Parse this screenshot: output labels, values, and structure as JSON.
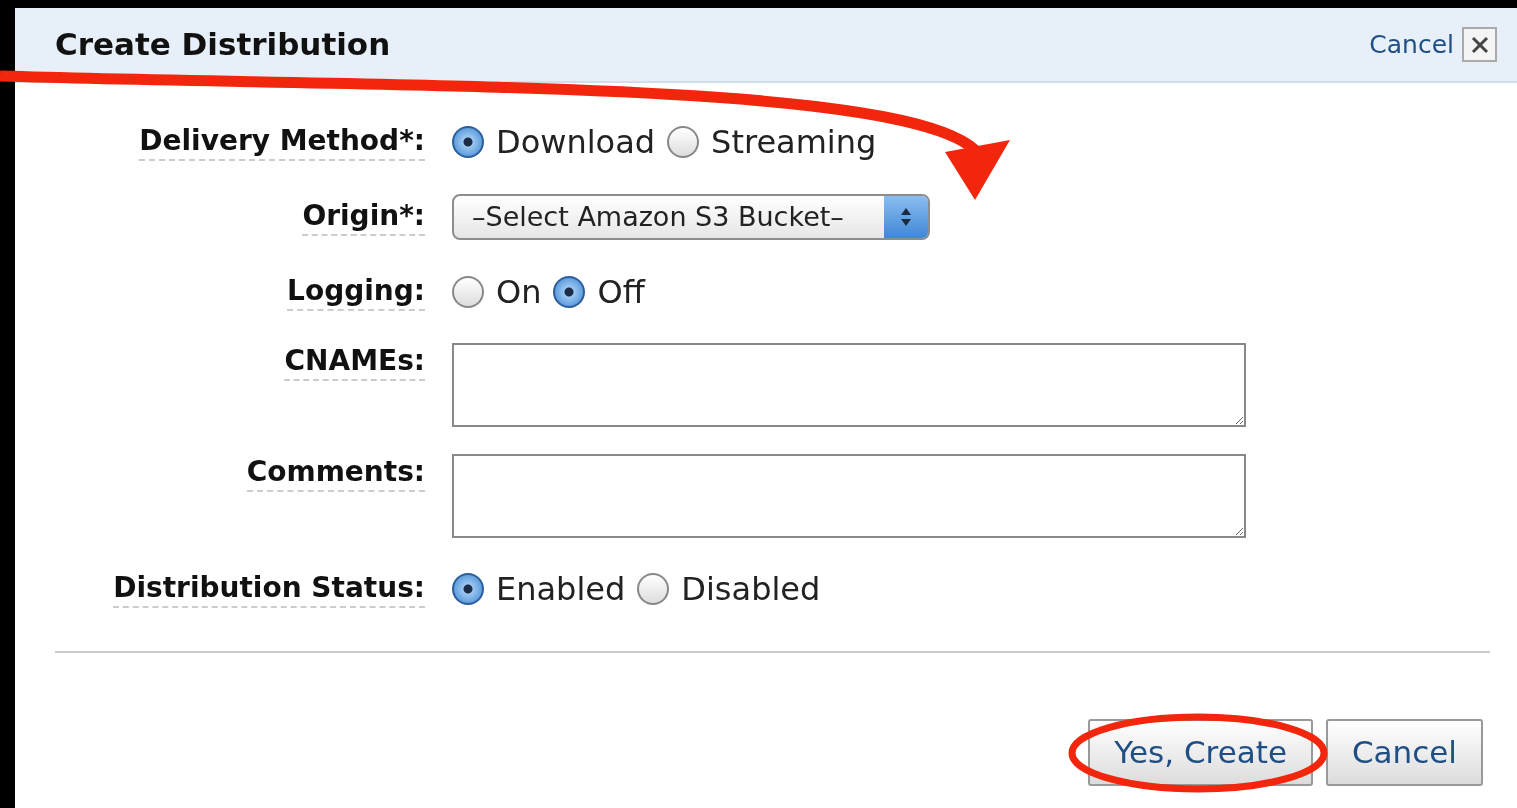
{
  "dialog": {
    "title": "Create Distribution",
    "close_link": "Cancel"
  },
  "fields": [
    {
      "kind": "radio",
      "label": "Delivery Method*:",
      "options": [
        {
          "label": "Download",
          "selected": true
        },
        {
          "label": "Streaming",
          "selected": false
        }
      ]
    },
    {
      "kind": "select",
      "label": "Origin*:",
      "value": "–Select Amazon S3 Bucket–"
    },
    {
      "kind": "radio",
      "label": "Logging:",
      "options": [
        {
          "label": "On",
          "selected": false
        },
        {
          "label": "Off",
          "selected": true
        }
      ]
    },
    {
      "kind": "textarea",
      "label": "CNAMEs:"
    },
    {
      "kind": "textarea",
      "label": "Comments:"
    },
    {
      "kind": "radio",
      "label": "Distribution Status:",
      "options": [
        {
          "label": "Enabled",
          "selected": true
        },
        {
          "label": "Disabled",
          "selected": false
        }
      ]
    }
  ],
  "buttons": [
    {
      "label": "Yes, Create"
    },
    {
      "label": "Cancel"
    }
  ]
}
